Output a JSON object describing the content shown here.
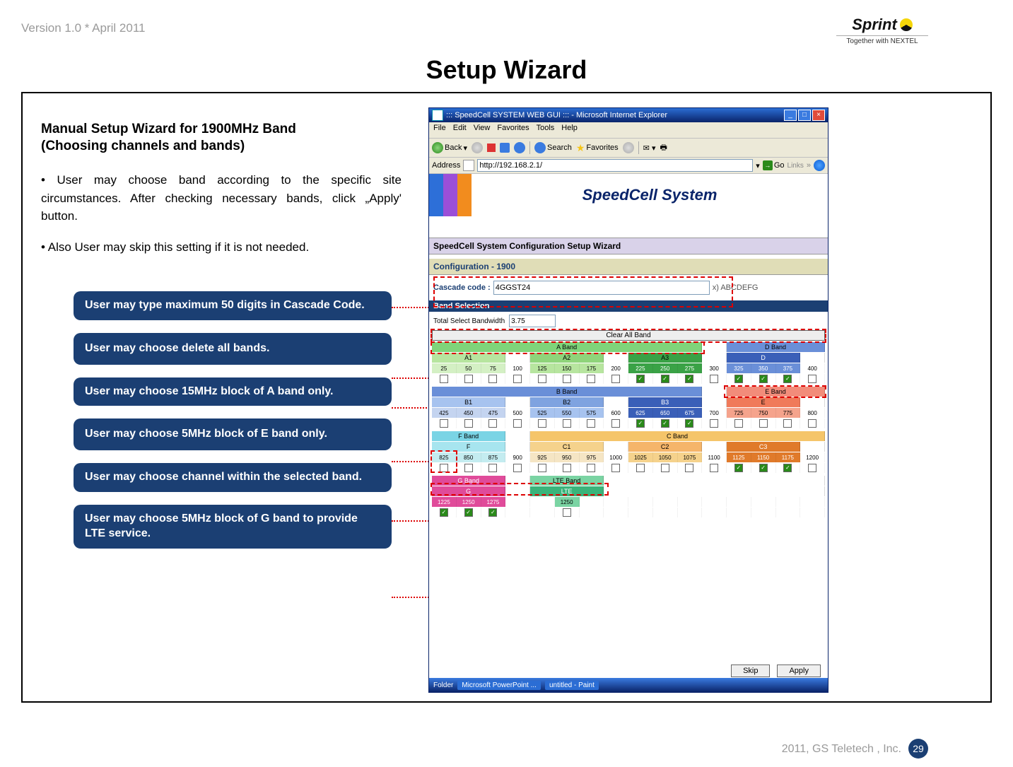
{
  "meta": {
    "version": "Version 1.0 * April 2011",
    "brand": "Sprint",
    "brand_tag": "Together with NEXTEL",
    "footer": "2011, GS Teletech , Inc.",
    "page_num": "29"
  },
  "title": "Setup Wizard",
  "left": {
    "h1": "Manual Setup Wizard for 1900MHz Band",
    "h2": " (Choosing channels and bands)",
    "p1": "• User may choose band according to the specific site circumstances. After checking necessary bands, click „Apply' button.",
    "p2": "•  Also User may skip this setting if it is not needed."
  },
  "callouts": [
    "User may type maximum 50 digits in Cascade Code.",
    "User may choose delete all bands.",
    "User may choose 15MHz block of A band only.",
    "User may choose 5MHz block of E band only.",
    "User may choose channel within the selected band.",
    "User may choose 5MHz block of G band to provide LTE service."
  ],
  "ie": {
    "title": "::: SpeedCell SYSTEM WEB GUI ::: - Microsoft Internet Explorer",
    "menu": [
      "File",
      "Edit",
      "View",
      "Favorites",
      "Tools",
      "Help"
    ],
    "back": "Back",
    "search": "Search",
    "fav": "Favorites",
    "addr_label": "Address",
    "addr_val": "http://192.168.2.1/",
    "go": "Go",
    "links": "Links",
    "brand_title": "SpeedCell System",
    "section": "SpeedCell System Configuration Setup Wizard",
    "subsection": "Configuration - 1900",
    "cascade_label": "Cascade code :",
    "cascade_val": "4GGST24",
    "cascade_hint": "x) ABCDEFG",
    "bs": "Band Selection",
    "tot_label": "Total Select Bandwidth",
    "tot_val": "3.75",
    "clear": "Clear All Band",
    "band_groups": {
      "A": "A Band",
      "D": "D Band",
      "E": "E Band",
      "B": "B Band",
      "F": "F Band",
      "C": "C Band",
      "G": "G Band",
      "LTE": "LTE Band"
    },
    "sub_bands": {
      "A1": "A1",
      "A2": "A2",
      "A3": "A3",
      "D": "D",
      "E": "E",
      "B1": "B1",
      "B2": "B2",
      "B3": "B3",
      "F": "F",
      "C1": "C1",
      "C2": "C2",
      "C3": "C3",
      "G": "G",
      "LTE": "LTE"
    },
    "row_a_d": [
      "25",
      "50",
      "75",
      "100",
      "125",
      "150",
      "175",
      "200",
      "225",
      "250",
      "275",
      "300",
      "325",
      "350",
      "375",
      "400"
    ],
    "row_b_e": [
      "425",
      "450",
      "475",
      "500",
      "525",
      "550",
      "575",
      "600",
      "625",
      "650",
      "675",
      "700",
      "725",
      "750",
      "775",
      "800"
    ],
    "row_f_c": [
      "825",
      "850",
      "875",
      "900",
      "925",
      "950",
      "975",
      "1000",
      "1025",
      "1050",
      "1075",
      "1100",
      "1125",
      "1150",
      "1175",
      "1200"
    ],
    "row_g_lte": [
      "1225",
      "1250",
      "1275",
      "",
      "",
      "1250",
      "",
      "",
      "",
      "",
      "",
      "",
      "",
      "",
      "",
      ""
    ],
    "skip": "Skip",
    "apply": "Apply",
    "task_folder": "Folder",
    "task1": "Microsoft PowerPoint ...",
    "task2": "untitled - Paint"
  }
}
